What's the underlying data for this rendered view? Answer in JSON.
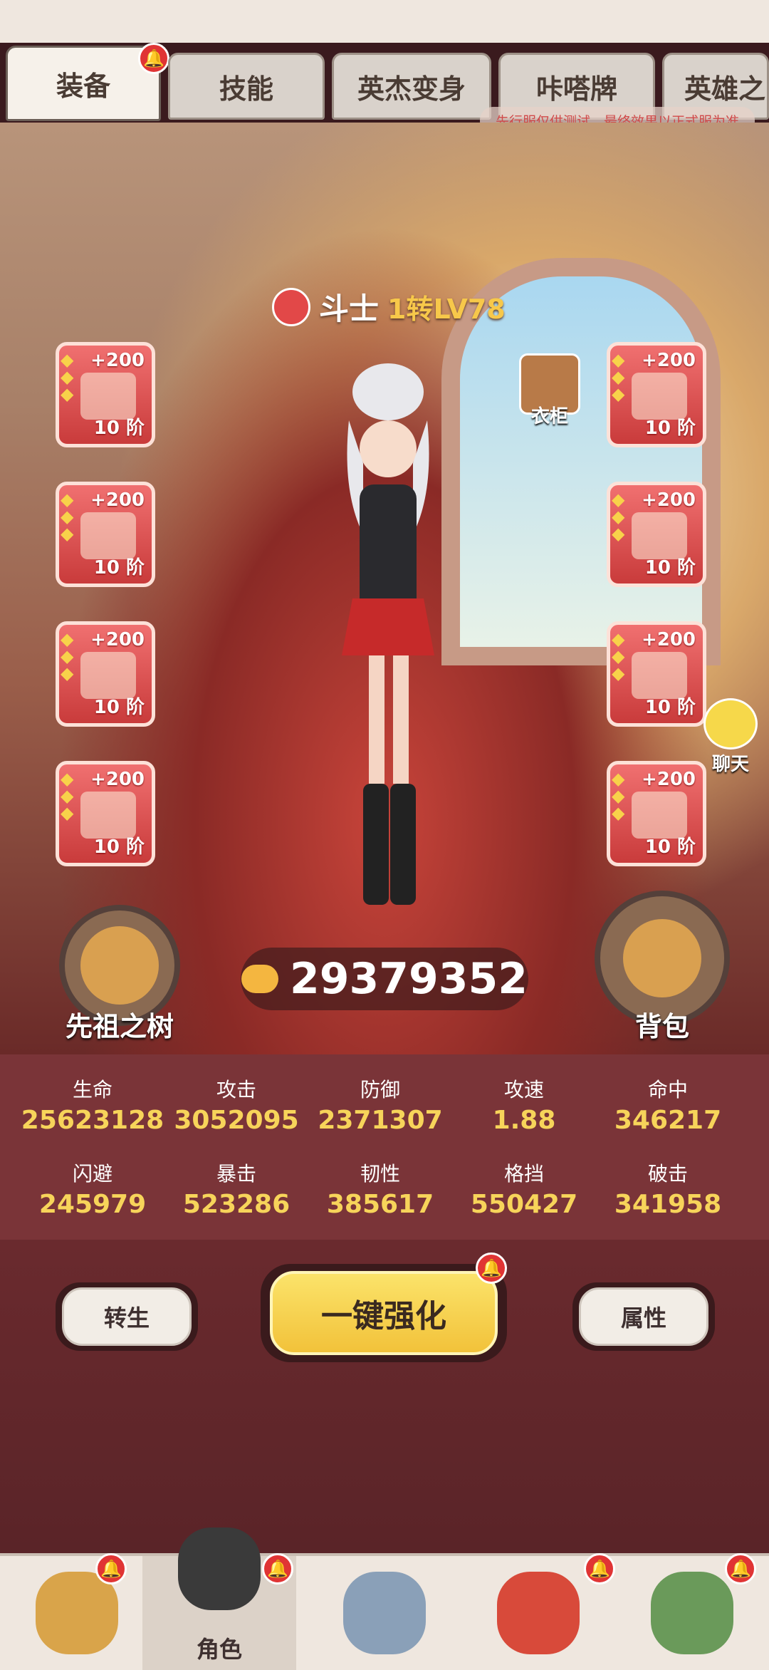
{
  "tabs": [
    {
      "label": "装备"
    },
    {
      "label": "技能"
    },
    {
      "label": "英杰变身"
    },
    {
      "label": "咔嗒牌"
    },
    {
      "label": "英雄之"
    }
  ],
  "notice": "先行服仅供测试，最终效果以正式服为准",
  "hero": {
    "class": "斗士",
    "level": "1转LV78"
  },
  "equipment_left": [
    {
      "plus": "+200",
      "tier": "10 阶"
    },
    {
      "plus": "+200",
      "tier": "10 阶"
    },
    {
      "plus": "+200",
      "tier": "10 阶"
    },
    {
      "plus": "+200",
      "tier": "10 阶"
    }
  ],
  "equipment_right": [
    {
      "plus": "+200",
      "tier": "10 阶"
    },
    {
      "plus": "+200",
      "tier": "10 阶"
    },
    {
      "plus": "+200",
      "tier": "10 阶"
    },
    {
      "plus": "+200",
      "tier": "10 阶"
    }
  ],
  "wardrobe_label": "衣柜",
  "chat_label": "聊天",
  "ancestor_tree_label": "先祖之树",
  "backpack_label": "背包",
  "combat_power": "29379352",
  "stats": [
    {
      "name": "生命",
      "value": "25623128"
    },
    {
      "name": "攻击",
      "value": "3052095"
    },
    {
      "name": "防御",
      "value": "2371307"
    },
    {
      "name": "攻速",
      "value": "1.88"
    },
    {
      "name": "命中",
      "value": "346217"
    },
    {
      "name": "闪避",
      "value": "245979"
    },
    {
      "name": "暴击",
      "value": "523286"
    },
    {
      "name": "韧性",
      "value": "385617"
    },
    {
      "name": "格挡",
      "value": "550427"
    },
    {
      "name": "破击",
      "value": "341958"
    }
  ],
  "actions": {
    "rebirth": "转生",
    "enhance_all": "一键强化",
    "attributes": "属性"
  },
  "bottom_nav": [
    {
      "label": ""
    },
    {
      "label": "角色"
    },
    {
      "label": ""
    },
    {
      "label": ""
    },
    {
      "label": ""
    }
  ],
  "colors": {
    "accent_gold": "#f7d45a",
    "slot_red": "#c93b3b",
    "badge_red": "#e03434"
  }
}
